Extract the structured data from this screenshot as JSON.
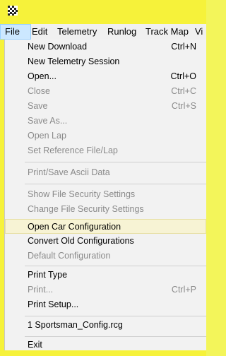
{
  "menubar": {
    "items": [
      "File",
      "Edit",
      "Telemetry",
      "Runlog",
      "Track Map",
      "Vi"
    ]
  },
  "file_menu": {
    "items": [
      {
        "label": "New Download",
        "shortcut": "Ctrl+N"
      },
      {
        "label": "New Telemetry Session",
        "shortcut": ""
      },
      {
        "label": "Open...",
        "shortcut": "Ctrl+O"
      },
      {
        "label": "Close",
        "shortcut": "Ctrl+C"
      },
      {
        "label": "Save",
        "shortcut": "Ctrl+S"
      },
      {
        "label": "Save As...",
        "shortcut": ""
      },
      {
        "label": "Open Lap",
        "shortcut": ""
      },
      {
        "label": "Set Reference File/Lap",
        "shortcut": ""
      },
      {
        "label": "Print/Save Ascii Data",
        "shortcut": ""
      },
      {
        "label": "Show File Security Settings",
        "shortcut": ""
      },
      {
        "label": "Change File Security Settings",
        "shortcut": ""
      },
      {
        "label": "Open Car Configuration",
        "shortcut": ""
      },
      {
        "label": "Convert Old Configurations",
        "shortcut": ""
      },
      {
        "label": "Default Configuration",
        "shortcut": ""
      },
      {
        "label": "Print Type",
        "shortcut": ""
      },
      {
        "label": "Print...",
        "shortcut": "Ctrl+P"
      },
      {
        "label": "Print Setup...",
        "shortcut": ""
      },
      {
        "label": "1 Sportsman_Config.rcg",
        "shortcut": ""
      },
      {
        "label": "Exit",
        "shortcut": ""
      }
    ]
  },
  "colors": {
    "window_frame": "#f6f23a",
    "menu_background": "#f2f2f2",
    "disabled_text": "#8a8a8a",
    "highlight": "#f7f3d4",
    "active_menu": "#cce8ff"
  }
}
